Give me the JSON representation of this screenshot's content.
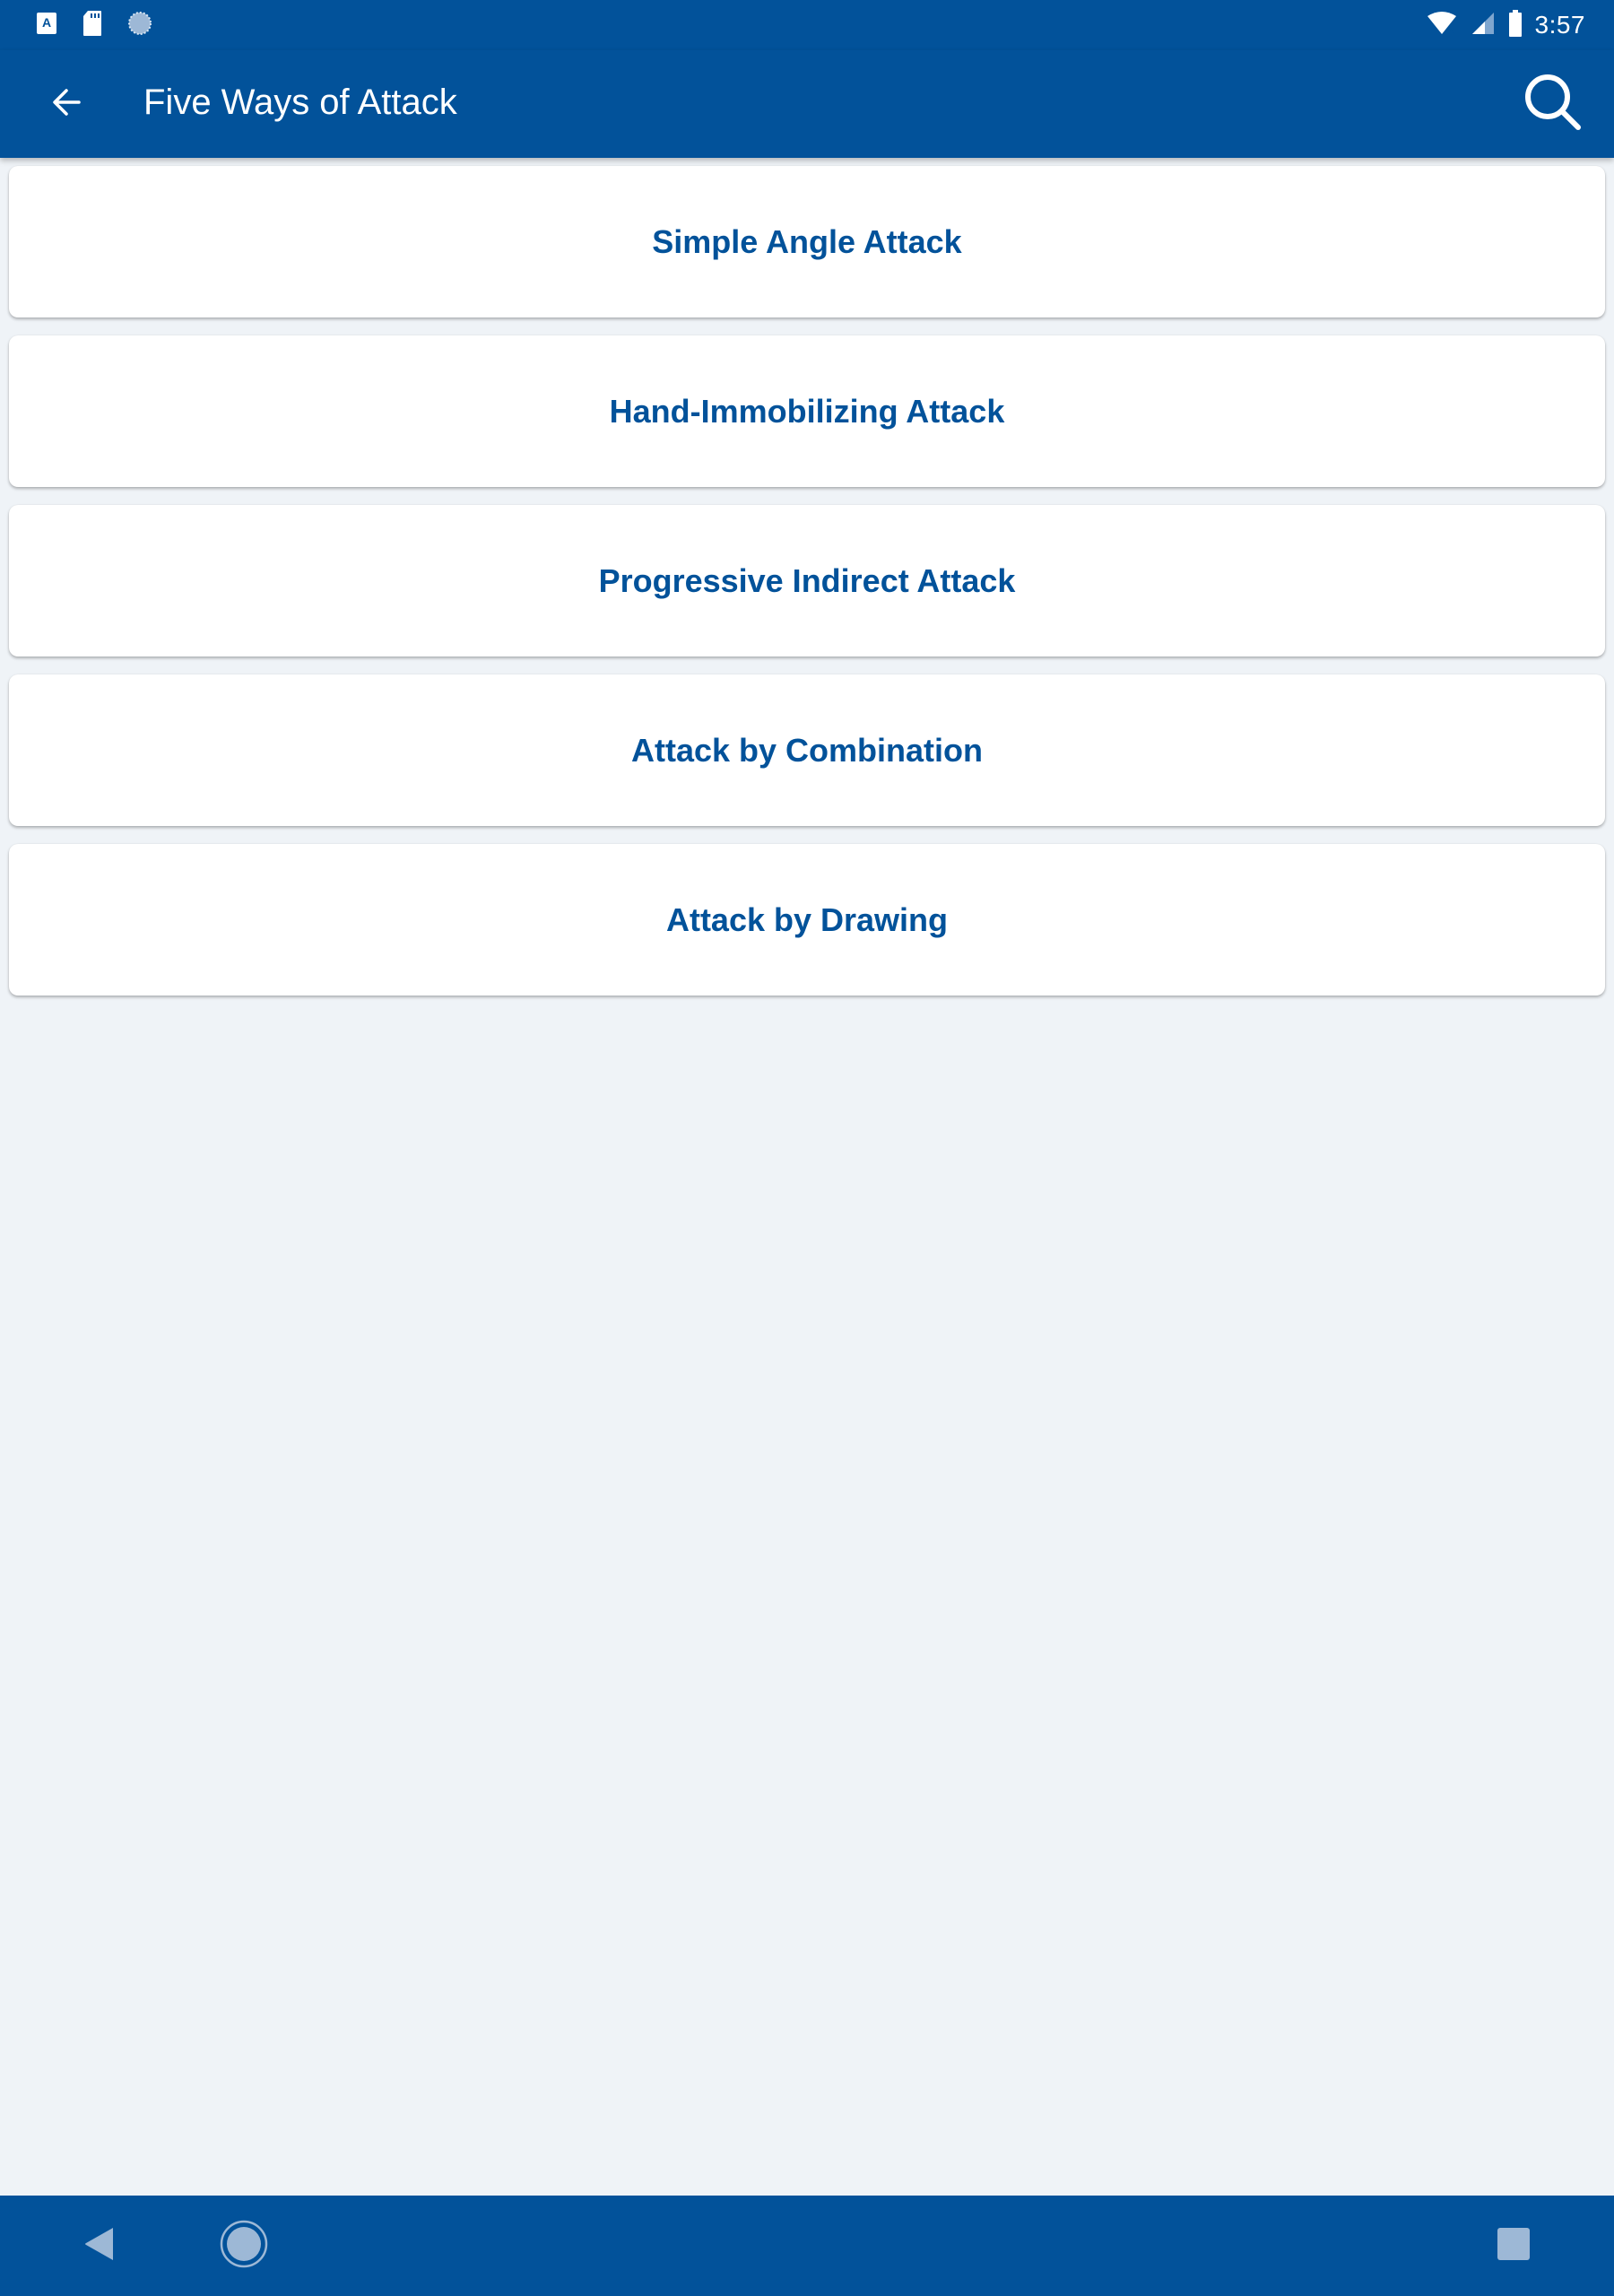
{
  "status_bar": {
    "left_icons": [
      "keyboard-a-icon",
      "sd-card-icon",
      "sync-circle-icon"
    ],
    "right_icons": [
      "wifi-off-icon",
      "cell-signal-icon",
      "battery-icon"
    ],
    "time": "3:57"
  },
  "toolbar": {
    "back_icon": "arrow-left-icon",
    "title": "Five Ways of Attack",
    "search_icon": "search-icon"
  },
  "list": {
    "items": [
      {
        "label": "Simple Angle Attack"
      },
      {
        "label": "Hand-Immobilizing Attack"
      },
      {
        "label": "Progressive Indirect Attack"
      },
      {
        "label": "Attack by Combination"
      },
      {
        "label": "Attack by Drawing"
      }
    ]
  },
  "nav_bar": {
    "buttons": [
      "back-triangle-icon",
      "home-circle-icon",
      "recents-square-icon"
    ]
  },
  "colors": {
    "primary": "#02529a",
    "background": "#eff3f7",
    "card": "#ffffff",
    "nav_icon": "#9db8d6"
  }
}
